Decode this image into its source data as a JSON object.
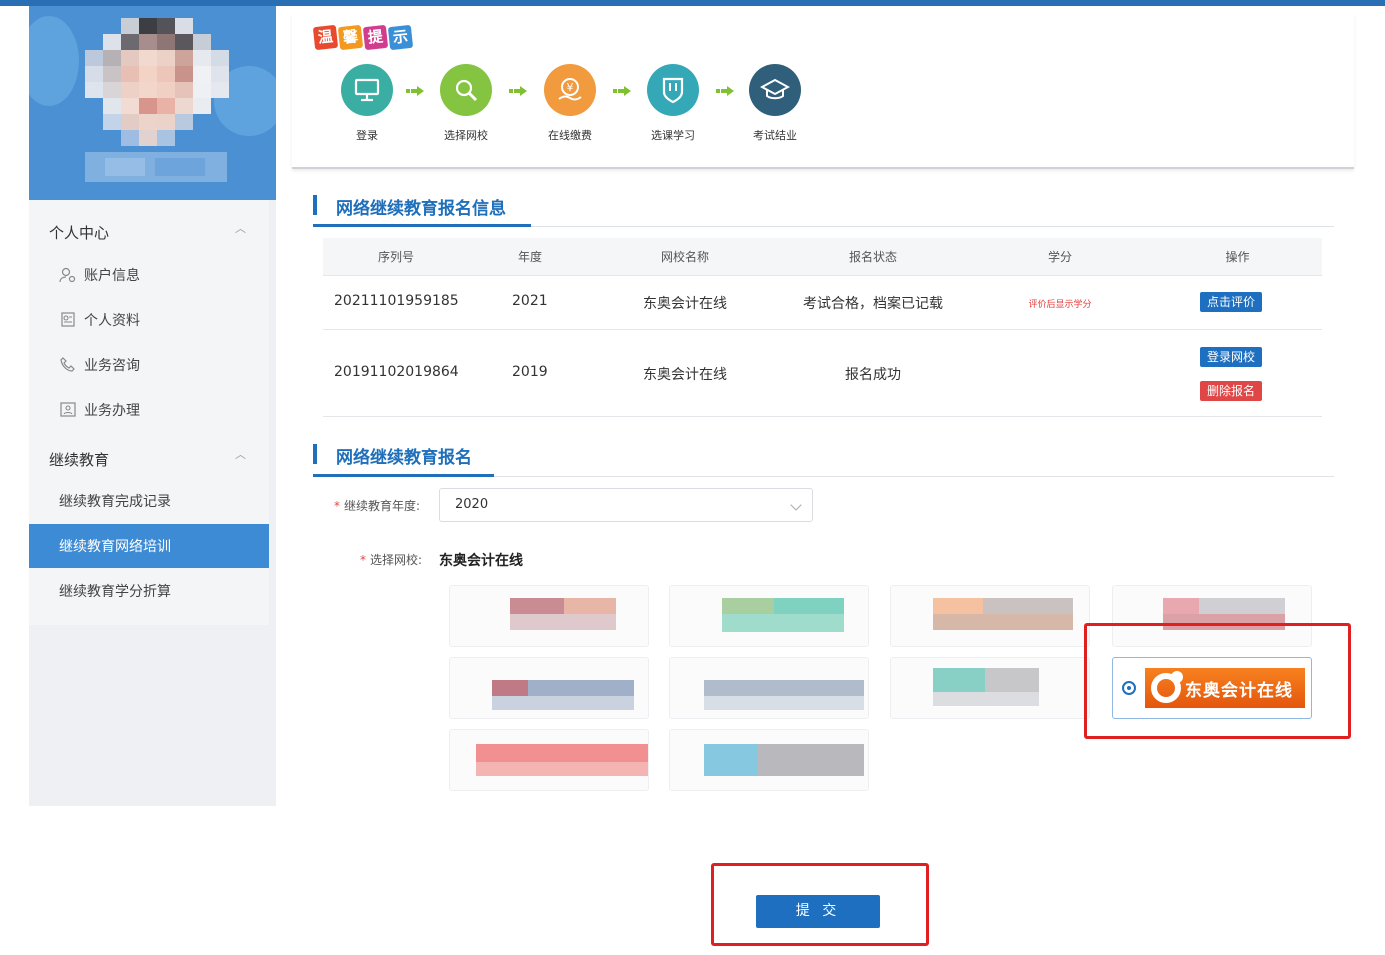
{
  "sidebar": {
    "groups": [
      {
        "label": "个人中心",
        "items": [
          "账户信息",
          "个人资料",
          "业务咨询",
          "业务办理"
        ]
      },
      {
        "label": "继续教育",
        "items": [
          "继续教育完成记录",
          "继续教育网络培训",
          "继续教育学分折算"
        ]
      }
    ],
    "active_item": "继续教育网络培训"
  },
  "tips": {
    "logo_chars": [
      "温",
      "馨",
      "提",
      "示"
    ],
    "steps": [
      "登录",
      "选择网校",
      "在线缴费",
      "选课学习",
      "考试结业"
    ]
  },
  "section1": {
    "title": "网络继续教育报名信息",
    "columns": [
      "序列号",
      "年度",
      "网校名称",
      "报名状态",
      "学分",
      "操作"
    ],
    "rows": [
      {
        "serial": "20211101959185",
        "year": "2021",
        "school": "东奥会计在线",
        "status": "考试合格，档案已记载",
        "credit": "评价后显示学分",
        "actions": [
          "点击评价"
        ]
      },
      {
        "serial": "20191102019864",
        "year": "2019",
        "school": "东奥会计在线",
        "status": "报名成功",
        "credit": "",
        "actions": [
          "登录网校",
          "删除报名"
        ]
      }
    ]
  },
  "section2": {
    "title": "网络继续教育报名",
    "year_label": "继续教育年度:",
    "year_value": "2020",
    "school_label": "选择网校:",
    "school_value": "东奥会计在线",
    "selected_logo_text": "东奥会计在线",
    "submit_label": "提 交"
  },
  "colors": {
    "accent": "#1f6fba",
    "active_menu": "#3d8bd4",
    "danger": "#e04646",
    "highlight_box": "#e02020"
  }
}
